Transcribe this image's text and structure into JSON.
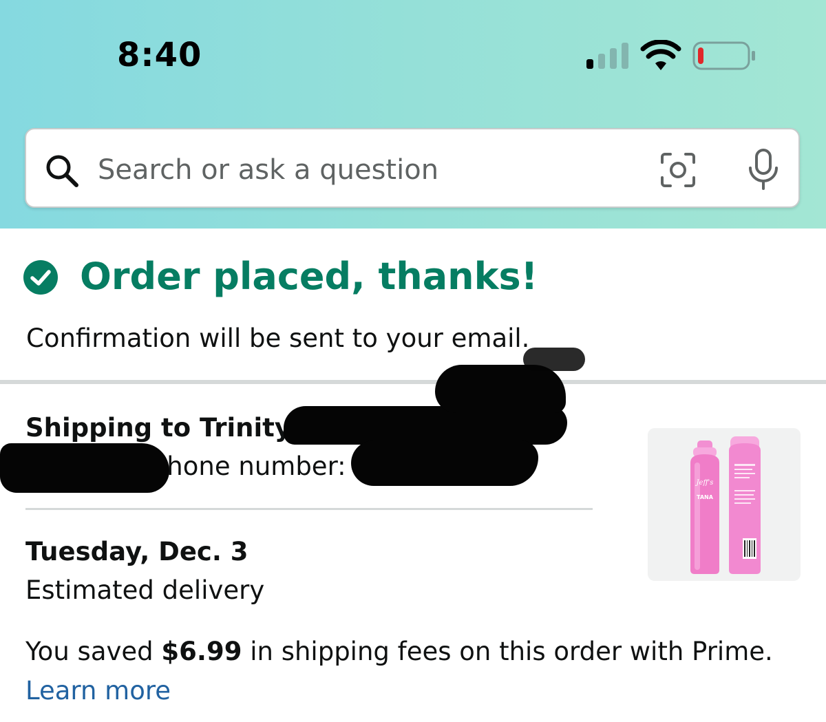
{
  "status_bar": {
    "time": "8:40",
    "signal_icon": "signal-icon",
    "wifi_icon": "wifi-icon",
    "battery_icon": "battery-low-icon",
    "battery_level": 0.08
  },
  "search": {
    "placeholder": "Search or ask a question",
    "icons": [
      "search-icon",
      "camera-icon",
      "microphone-icon"
    ]
  },
  "order": {
    "title": "Order placed, thanks!",
    "confirmation": "Confirmation will be sent to your email.",
    "shipping_to": "Shipping to Trinity W",
    "phone_label": "Phone number:",
    "delivery_date": "Tuesday, Dec. 3",
    "delivery_label": "Estimated delivery",
    "savings_prefix": "You saved ",
    "savings_amount": "$6.99",
    "savings_suffix": " in shipping fees on this order with Prime.",
    "learn_more": "Learn more"
  },
  "product": {
    "brand_text": "Jeff's",
    "variant_text": "TANA"
  },
  "colors": {
    "header_gradient_start": "#85d9e0",
    "header_gradient_end": "#a3e6d4",
    "success_green": "#067d62",
    "link_blue": "#2162a1",
    "battery_red": "#e0282a",
    "product_pink": "#f07dc8"
  }
}
